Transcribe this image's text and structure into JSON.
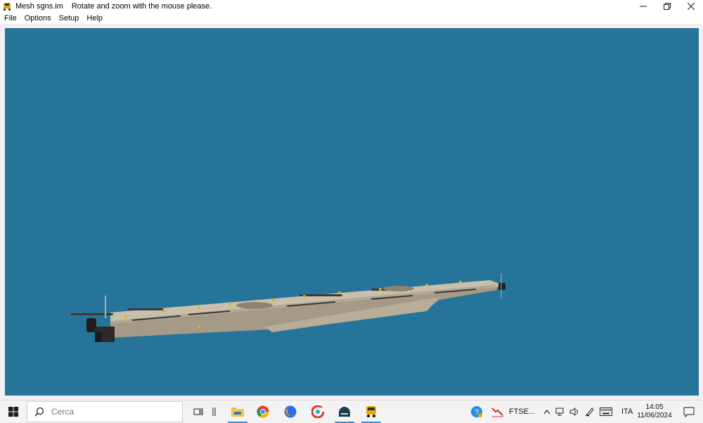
{
  "window": {
    "app_name": "Mesh sgns.im",
    "instruction": "Rotate and zoom with the mouse please."
  },
  "menu": {
    "items": [
      "File",
      "Options",
      "Setup",
      "Help"
    ]
  },
  "viewport": {
    "background_color": "#26749a"
  },
  "taskbar": {
    "search_placeholder": "Cerca",
    "stock_label": "FTSE...",
    "language": "ITA",
    "time": "14:05",
    "date": "11/06/2024"
  }
}
